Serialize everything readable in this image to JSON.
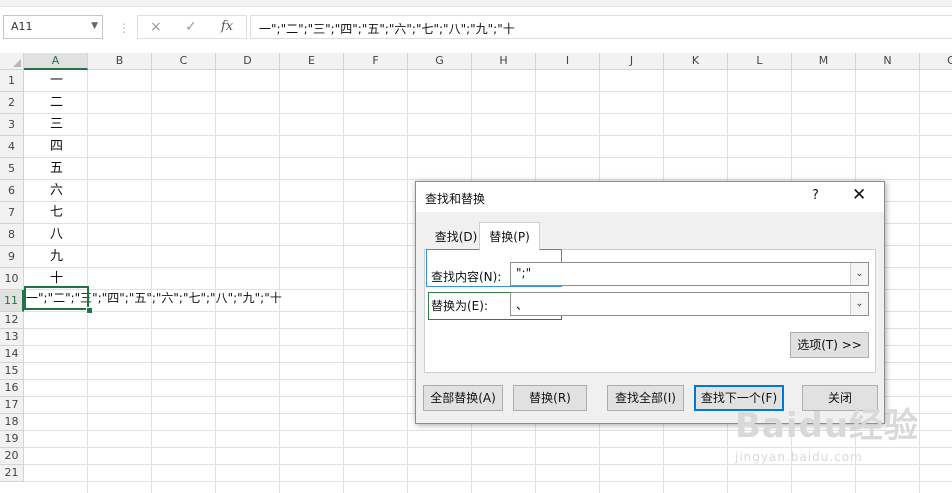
{
  "formula_bar": {
    "name_box": "A11",
    "cancel_icon": "×",
    "enter_icon": "✓",
    "fx_label": "fx",
    "formula": "一\";\"二\";\"三\";\"四\";\"五\";\"六\";\"七\";\"八\";\"九\";\"十"
  },
  "sheet": {
    "columns": [
      "A",
      "B",
      "C",
      "D",
      "E",
      "F",
      "G",
      "H",
      "I",
      "J",
      "K",
      "L",
      "M",
      "N",
      "O"
    ],
    "selected_column": "A",
    "rows": [
      "1",
      "2",
      "3",
      "4",
      "5",
      "6",
      "7",
      "8",
      "9",
      "10",
      "11",
      "12",
      "13",
      "14",
      "15",
      "16",
      "17",
      "18",
      "19",
      "20",
      "21"
    ],
    "selected_row": "11",
    "column_a_values": [
      "一",
      "二",
      "三",
      "四",
      "五",
      "六",
      "七",
      "八",
      "九",
      "十"
    ],
    "a11_value": "一\";\"二\";\"三\";\"四\";\"五\";\"六\";\"七\";\"八\";\"九\";\"十"
  },
  "dialog": {
    "title": "查找和替换",
    "help": "?",
    "close": "✕",
    "tabs": {
      "find": "查找(D)",
      "replace": "替换(P)"
    },
    "active_tab": "替换(P)",
    "find_label": "查找内容(N):",
    "find_value": "\";\"",
    "replace_label": "替换为(E):",
    "replace_value": "、",
    "options_button": "选项(T) >>",
    "buttons": {
      "replace_all": "全部替换(A)",
      "replace": "替换(R)",
      "find_all": "查找全部(I)",
      "find_next": "查找下一个(F)",
      "close": "关闭"
    }
  },
  "watermark": {
    "logo": "Baidu经验",
    "url": "jingyan.baidu.com"
  },
  "colors": {
    "excel_green": "#217346",
    "focus_blue": "#0078d7"
  }
}
